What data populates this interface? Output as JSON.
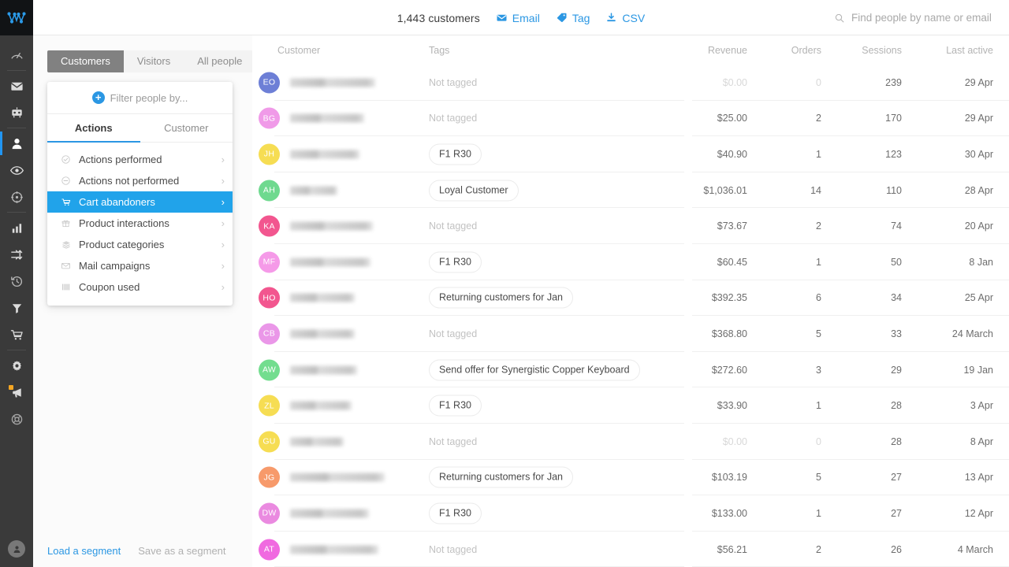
{
  "brand": {
    "logo_icon": "metrilo-logo-icon"
  },
  "rail": {
    "items": [
      {
        "name": "dashboard",
        "icon": "gauge-icon",
        "active": false
      },
      {
        "name": "email",
        "icon": "envelope-icon",
        "active": false
      },
      {
        "name": "automation",
        "icon": "robot-icon",
        "active": false
      },
      {
        "name": "customers",
        "icon": "person-icon",
        "active": true
      },
      {
        "name": "live-view",
        "icon": "eye-icon",
        "active": false
      },
      {
        "name": "targeting",
        "icon": "crosshair-icon",
        "active": false
      },
      {
        "name": "analytics",
        "icon": "bar-chart-icon",
        "active": false
      },
      {
        "name": "funnels",
        "icon": "shuffle-icon",
        "active": false
      },
      {
        "name": "history",
        "icon": "clock-back-icon",
        "active": false
      },
      {
        "name": "filters",
        "icon": "funnel-icon",
        "active": false
      },
      {
        "name": "orders",
        "icon": "cart-icon",
        "active": false
      },
      {
        "name": "settings",
        "icon": "gear-icon",
        "active": false
      },
      {
        "name": "announcements",
        "icon": "megaphone-icon",
        "active": false,
        "badge": true
      },
      {
        "name": "help",
        "icon": "lifebuoy-icon",
        "active": false
      }
    ],
    "user_avatar_icon": "user-avatar-icon"
  },
  "topbar": {
    "count_label": "1,443 customers",
    "actions": [
      {
        "label": "Email",
        "icon": "envelope-icon"
      },
      {
        "label": "Tag",
        "icon": "tag-icon"
      },
      {
        "label": "CSV",
        "icon": "download-icon"
      }
    ],
    "search": {
      "icon": "search-icon",
      "placeholder": "Find people by name or email",
      "value": ""
    }
  },
  "segment_tabs": [
    {
      "label": "Customers",
      "active": true
    },
    {
      "label": "Visitors",
      "active": false
    },
    {
      "label": "All people",
      "active": false
    }
  ],
  "filter_popover": {
    "header": {
      "icon": "plus-circle-icon",
      "label": "Filter people by..."
    },
    "tabs": [
      {
        "label": "Actions",
        "active": true
      },
      {
        "label": "Customer",
        "active": false
      }
    ],
    "items": [
      {
        "label": "Actions performed",
        "icon": "check-circle-icon",
        "selected": false,
        "chevron": "›"
      },
      {
        "label": "Actions not performed",
        "icon": "minus-circle-icon",
        "selected": false,
        "chevron": "›"
      },
      {
        "label": "Cart abandoners",
        "icon": "cart-icon",
        "selected": true,
        "chevron": "›"
      },
      {
        "label": "Product interactions",
        "icon": "gift-icon",
        "selected": false,
        "chevron": "›"
      },
      {
        "label": "Product categories",
        "icon": "layers-icon",
        "selected": false,
        "chevron": "›"
      },
      {
        "label": "Mail campaigns",
        "icon": "envelope-icon",
        "selected": false,
        "chevron": "›"
      },
      {
        "label": "Coupon used",
        "icon": "coupon-icon",
        "selected": false,
        "chevron": "›"
      }
    ]
  },
  "segment_footer": {
    "load_label": "Load a segment",
    "save_label": "Save as a segment"
  },
  "table": {
    "columns": [
      "Customer",
      "Tags",
      "Revenue",
      "Orders",
      "Sessions",
      "Last active"
    ],
    "rows": [
      {
        "initials": "EO",
        "color": "#6d7fd6",
        "name_redacted": true,
        "name_width": 108,
        "tag": "Not tagged",
        "tagged": false,
        "revenue": "$0.00",
        "revenue_muted": true,
        "orders": "0",
        "orders_muted": true,
        "sessions": "239",
        "last_active": "29 Apr"
      },
      {
        "initials": "BG",
        "color": "#f09ae8",
        "name_redacted": true,
        "name_width": 94,
        "tag": "Not tagged",
        "tagged": false,
        "revenue": "$25.00",
        "revenue_muted": false,
        "orders": "2",
        "orders_muted": false,
        "sessions": "170",
        "last_active": "29 Apr"
      },
      {
        "initials": "JH",
        "color": "#f6dd53",
        "name_redacted": true,
        "name_width": 88,
        "tag": "F1 R30",
        "tagged": true,
        "revenue": "$40.90",
        "revenue_muted": false,
        "orders": "1",
        "orders_muted": false,
        "sessions": "123",
        "last_active": "30 Apr"
      },
      {
        "initials": "AH",
        "color": "#6fd98f",
        "name_redacted": true,
        "name_width": 60,
        "tag": "Loyal Customer",
        "tagged": true,
        "revenue": "$1,036.01",
        "revenue_muted": false,
        "orders": "14",
        "orders_muted": false,
        "sessions": "110",
        "last_active": "28 Apr"
      },
      {
        "initials": "KA",
        "color": "#f2568f",
        "name_redacted": true,
        "name_width": 105,
        "tag": "Not tagged",
        "tagged": false,
        "revenue": "$73.67",
        "revenue_muted": false,
        "orders": "2",
        "orders_muted": false,
        "sessions": "74",
        "last_active": "20 Apr"
      },
      {
        "initials": "MF",
        "color": "#f59ae8",
        "name_redacted": true,
        "name_width": 102,
        "tag": "F1 R30",
        "tagged": true,
        "revenue": "$60.45",
        "revenue_muted": false,
        "orders": "1",
        "orders_muted": false,
        "sessions": "50",
        "last_active": "8 Jan"
      },
      {
        "initials": "HO",
        "color": "#f2568f",
        "name_redacted": true,
        "name_width": 82,
        "tag": "Returning customers for Jan",
        "tagged": true,
        "revenue": "$392.35",
        "revenue_muted": false,
        "orders": "6",
        "orders_muted": false,
        "sessions": "34",
        "last_active": "25 Apr"
      },
      {
        "initials": "CB",
        "color": "#ea97e8",
        "name_redacted": true,
        "name_width": 82,
        "tag": "Not tagged",
        "tagged": false,
        "revenue": "$368.80",
        "revenue_muted": false,
        "orders": "5",
        "orders_muted": false,
        "sessions": "33",
        "last_active": "24 March"
      },
      {
        "initials": "AW",
        "color": "#73dd8f",
        "name_redacted": true,
        "name_width": 85,
        "tag": "Send offer for Synergistic Copper Keyboard",
        "tagged": true,
        "revenue": "$272.60",
        "revenue_muted": false,
        "orders": "3",
        "orders_muted": false,
        "sessions": "29",
        "last_active": "19 Jan"
      },
      {
        "initials": "ZL",
        "color": "#f6dd53",
        "name_redacted": true,
        "name_width": 78,
        "tag": "F1 R30",
        "tagged": true,
        "revenue": "$33.90",
        "revenue_muted": false,
        "orders": "1",
        "orders_muted": false,
        "sessions": "28",
        "last_active": "3 Apr"
      },
      {
        "initials": "GU",
        "color": "#f6dd53",
        "name_redacted": true,
        "name_width": 68,
        "tag": "Not tagged",
        "tagged": false,
        "revenue": "$0.00",
        "revenue_muted": true,
        "orders": "0",
        "orders_muted": true,
        "sessions": "28",
        "last_active": "8 Apr"
      },
      {
        "initials": "JG",
        "color": "#f79a6b",
        "name_redacted": true,
        "name_width": 120,
        "tag": "Returning customers for Jan",
        "tagged": true,
        "revenue": "$103.19",
        "revenue_muted": false,
        "orders": "5",
        "orders_muted": false,
        "sessions": "27",
        "last_active": "13 Apr"
      },
      {
        "initials": "DW",
        "color": "#ea8ae0",
        "name_redacted": true,
        "name_width": 100,
        "tag": "F1 R30",
        "tagged": true,
        "revenue": "$133.00",
        "revenue_muted": false,
        "orders": "1",
        "orders_muted": false,
        "sessions": "27",
        "last_active": "12 Apr"
      },
      {
        "initials": "AT",
        "color": "#f06ae0",
        "name_redacted": true,
        "name_width": 112,
        "tag": "Not tagged",
        "tagged": false,
        "revenue": "$56.21",
        "revenue_muted": false,
        "orders": "2",
        "orders_muted": false,
        "sessions": "26",
        "last_active": "4 March"
      }
    ]
  },
  "colors": {
    "accent": "#2b97e3",
    "selected_row": "#21a3ea",
    "rail_bg": "#3a3a3a",
    "logo_bg": "#111315"
  }
}
